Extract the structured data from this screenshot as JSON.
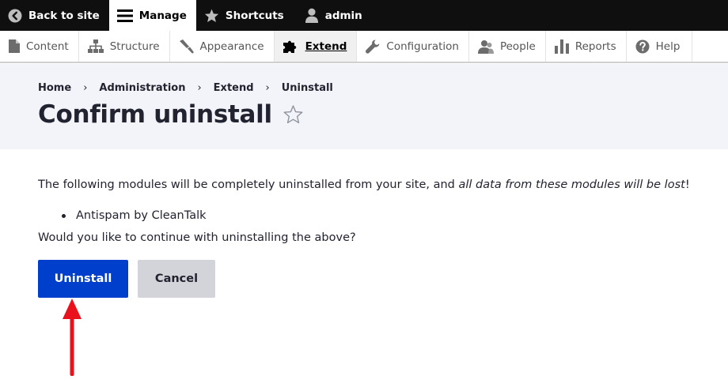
{
  "toolbar": {
    "back_to_site": "Back to site",
    "manage": "Manage",
    "shortcuts": "Shortcuts",
    "user": "admin"
  },
  "tray": {
    "items": [
      {
        "label": "Content",
        "icon": "file-icon"
      },
      {
        "label": "Structure",
        "icon": "sitemap-icon"
      },
      {
        "label": "Appearance",
        "icon": "paintbrush-icon"
      },
      {
        "label": "Extend",
        "icon": "puzzle-icon",
        "active": true
      },
      {
        "label": "Configuration",
        "icon": "wrench-icon"
      },
      {
        "label": "People",
        "icon": "people-icon"
      },
      {
        "label": "Reports",
        "icon": "bar-chart-icon"
      },
      {
        "label": "Help",
        "icon": "help-icon"
      }
    ]
  },
  "breadcrumb": [
    "Home",
    "Administration",
    "Extend",
    "Uninstall"
  ],
  "breadcrumb_separator": "›",
  "page": {
    "title": "Confirm uninstall"
  },
  "content": {
    "intro_text": "The following modules will be completely uninstalled from your site, and ",
    "intro_emphasis": "all data from these modules will be lost",
    "intro_end": "!",
    "modules": [
      "Antispam by CleanTalk"
    ],
    "question": "Would you like to continue with uninstalling the above?"
  },
  "actions": {
    "uninstall_label": "Uninstall",
    "cancel_label": "Cancel"
  },
  "colors": {
    "primary": "#003ecc",
    "toolbar": "#0f0f0f",
    "header_bg": "#f3f4f9",
    "arrow": "#e8111c"
  }
}
